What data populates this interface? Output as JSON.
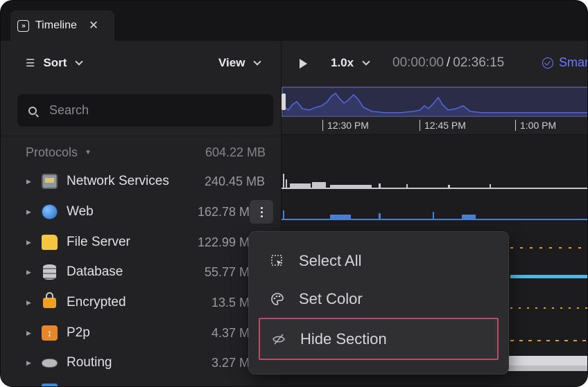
{
  "tab": {
    "title": "Timeline",
    "icon": "sidebar-expand-icon",
    "close_glyph": "✕"
  },
  "toolbar": {
    "sort_label": "Sort",
    "view_label": "View",
    "speed_label": "1.0x",
    "current_time": "00:00:00",
    "separator": "/",
    "duration": "02:36:15",
    "smart_label": "Smar"
  },
  "search": {
    "placeholder": "Search",
    "value": ""
  },
  "protocols": {
    "header": "Protocols",
    "total": "604.22 MB",
    "items": [
      {
        "name": "Network Services",
        "size": "240.45 MB",
        "icon": "network-services-icon",
        "color": "#9aa3a8"
      },
      {
        "name": "Web",
        "size": "162.78 M",
        "icon": "globe-icon",
        "color": "#3d8bd9"
      },
      {
        "name": "File Server",
        "size": "122.99 M",
        "icon": "folder-icon",
        "color": "#f5c542"
      },
      {
        "name": "Database",
        "size": "55.77 M",
        "icon": "database-icon",
        "color": "#b5b5ba"
      },
      {
        "name": "Encrypted",
        "size": "13.5 M",
        "icon": "lock-icon",
        "color": "#f0a020"
      },
      {
        "name": "P2p",
        "size": "4.37 M",
        "icon": "p2p-icon",
        "color": "#e8862a"
      },
      {
        "name": "Routing",
        "size": "3.27 M",
        "icon": "router-icon",
        "color": "#c8c8cc"
      }
    ]
  },
  "timeline": {
    "ticks": [
      "12:30 PM",
      "12:45 PM",
      "1:00 PM"
    ]
  },
  "context_menu": {
    "items": [
      {
        "label": "Select All",
        "icon": "select-all-icon"
      },
      {
        "label": "Set Color",
        "icon": "palette-icon"
      },
      {
        "label": "Hide Section",
        "icon": "eye-off-icon"
      }
    ]
  },
  "colors": {
    "accent": "#6b7bff",
    "highlight_border": "#c0496a",
    "track_web": "#4a7fd0",
    "track_file": "#e0a030",
    "track_db": "#4fb8e0"
  }
}
